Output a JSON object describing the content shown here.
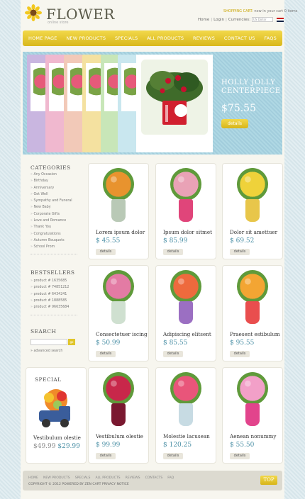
{
  "header": {
    "logo": "FLOWER",
    "logo_sub": "online store",
    "cart_link": "SHOPPING CART:",
    "cart_text": "now in your cart 0 items",
    "links": [
      "Home",
      "Login",
      "Currencies:"
    ],
    "currency": "US Dollar"
  },
  "nav": [
    "HOME PAGE",
    "NEW PRODUCTS",
    "SPECIALS",
    "ALL PRODUCTS",
    "REVIEWS",
    "CONTACT US",
    "FAQS"
  ],
  "banner": {
    "title_line1": "HOLLY JOLLY",
    "title_line2": "CENTERPIECE",
    "price": "$75.55",
    "button": "details",
    "fan_colors": [
      "#c9b6e0",
      "#f0b8cf",
      "#f2c9b8",
      "#f4e1a0",
      "#c8e6b8",
      "#c9e7ef"
    ]
  },
  "sidebar": {
    "categories_title": "CATEGORIES",
    "categories": [
      "Any Occasion",
      "Birthday",
      "Anniversary",
      "Get Well",
      "Sympathy and Funeral",
      "New Baby",
      "Corporate Gifts",
      "Love and Romance",
      "Thank You",
      "Congratulations",
      "Autumn Bouquets",
      "School Prom"
    ],
    "bestsellers_title": "BESTSELLERS",
    "bestsellers": [
      "product # 1635685",
      "product # 74851212",
      "product # 6434241",
      "product # 1888585",
      "product # 96635684"
    ],
    "search_title": "SEARCH",
    "search_button": "go",
    "advanced": "advanced search"
  },
  "products": [
    {
      "name": "Lorem ipsum dolor",
      "price": "$ 45.55",
      "details": "details",
      "flower": "#e8932e",
      "vase": "#b9c9b6"
    },
    {
      "name": "Ipsum dolor sitmet",
      "price": "$ 85.99",
      "details": "details",
      "flower": "#e9a2b6",
      "vase": "#e0457a"
    },
    {
      "name": "Dolor sit amettuer",
      "price": "$ 69.52",
      "details": "details",
      "flower": "#efd23a",
      "vase": "#e8c64a"
    },
    {
      "name": "Consectetuer iscing",
      "price": "$ 50.99",
      "details": "details",
      "flower": "#e37ba4",
      "vase": "#cfe0d0"
    },
    {
      "name": "Adipiscing elitsent",
      "price": "$ 85.55",
      "details": "details",
      "flower": "#ee6a3d",
      "vase": "#9b6fc2"
    },
    {
      "name": "Praesent estibulum",
      "price": "$ 95.55",
      "details": "details",
      "flower": "#f3a533",
      "vase": "#e94e4e"
    }
  ],
  "special": {
    "title": "SPECIAL",
    "items": [
      {
        "name": "Vestibulum olestie",
        "old_price": "$49.99",
        "price": "$29.99",
        "flower": "#f08a2a",
        "vase": "#3a5d9b"
      },
      {
        "name": "Vestibulum olestie",
        "price": "$ 99.99",
        "details": "details",
        "flower": "#c8274a",
        "vase": "#7a1830"
      },
      {
        "name": "Molestie lacusean",
        "price": "$ 120.25",
        "details": "details",
        "flower": "#e9557a",
        "vase": "#c7dbe3"
      },
      {
        "name": "Aenean nonummy",
        "price": "$ 55.50",
        "details": "details",
        "flower": "#f2a0c8",
        "vase": "#e2448c"
      }
    ]
  },
  "footer": {
    "links": [
      "HOME",
      "NEW PRODUCTS",
      "SPECIALS",
      "ALL PRODUCTS",
      "REVIEWS",
      "CONTACTS",
      "FAQ"
    ],
    "copyright": "COPYRIGHT © 2012 POWERED BY ZEN CART PRIVACY NOTICE",
    "top": "TOP"
  }
}
